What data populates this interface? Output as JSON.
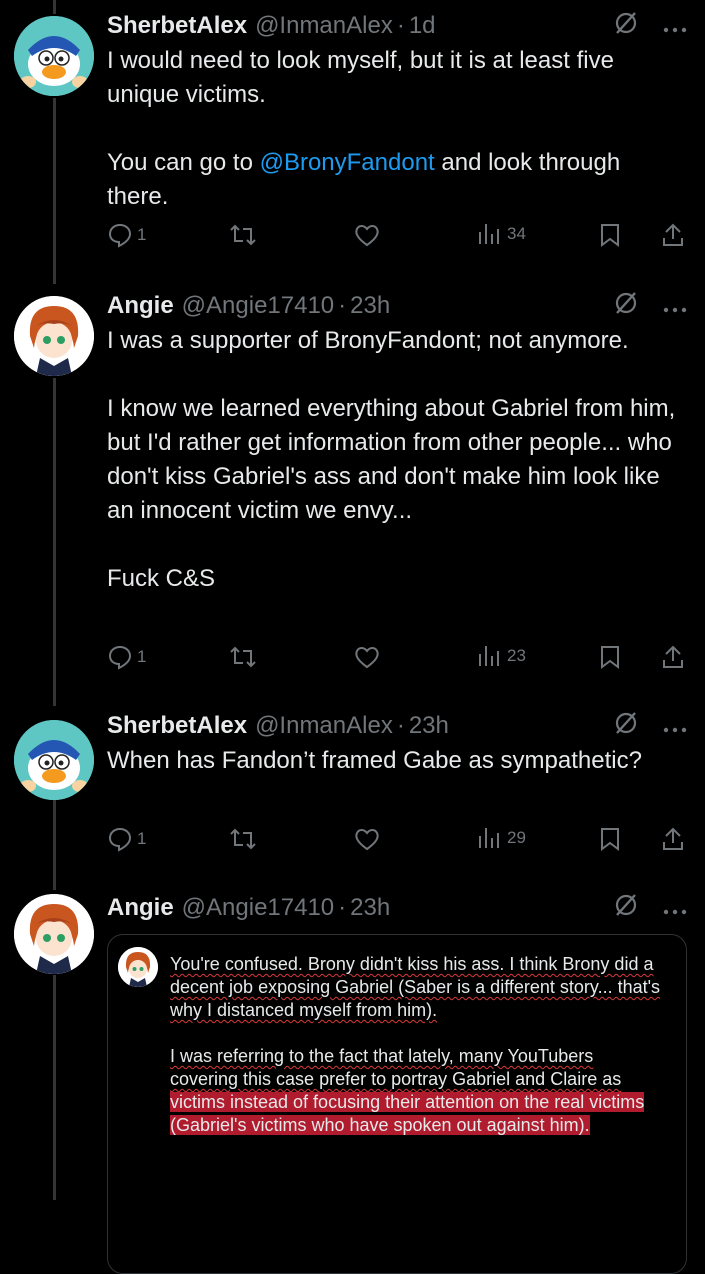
{
  "tweets": [
    {
      "name": "SherbetAlex",
      "handle": "@InmanAlex",
      "time": "1d",
      "paragraphs": [
        "I would need to look myself, but it is at least five unique victims.",
        [
          "You can go to ",
          "@BronyFandont",
          " and look through there."
        ]
      ],
      "stats": {
        "replies": "1",
        "views": "34"
      }
    },
    {
      "name": "Angie",
      "handle": "@Angie17410",
      "time": "23h",
      "paragraphs": [
        "I was a supporter of BronyFandont; not anymore.",
        "I know we learned everything about Gabriel from him, but I'd rather get information from other people... who don't kiss Gabriel's ass and don't make him look like an innocent victim we envy...",
        "Fuck C&S"
      ],
      "stats": {
        "replies": "1",
        "views": "23"
      }
    },
    {
      "name": "SherbetAlex",
      "handle": "@InmanAlex",
      "time": "23h",
      "paragraphs": [
        "When has Fandon’t framed Gabe as sympathetic?"
      ],
      "stats": {
        "replies": "1",
        "views": "29"
      }
    },
    {
      "name": "Angie",
      "handle": "@Angie17410",
      "time": "23h"
    }
  ],
  "quote": {
    "p1": "You're confused. Brony didn't kiss his ass. I think Brony did a decent job exposing Gabriel (Saber is a different story... that's why I distanced myself from him).",
    "p2_plain": "I was referring to the fact that lately, many YouTubers covering this case prefer to portray Gabriel and Claire as",
    "p2_highlight": "victims instead of focusing their attention on the real victims (Gabriel's victims who have spoken out against him)."
  },
  "header_separator": "·",
  "colors": {
    "background": "#000000",
    "text": "#e7e9ea",
    "muted": "#71767b",
    "link": "#1d9bf0",
    "highlight": "#b01c2e"
  },
  "icons": [
    "reply-icon",
    "retweet-icon",
    "like-icon",
    "views-icon",
    "bookmark-icon",
    "share-icon",
    "grok-icon",
    "more-icon"
  ]
}
